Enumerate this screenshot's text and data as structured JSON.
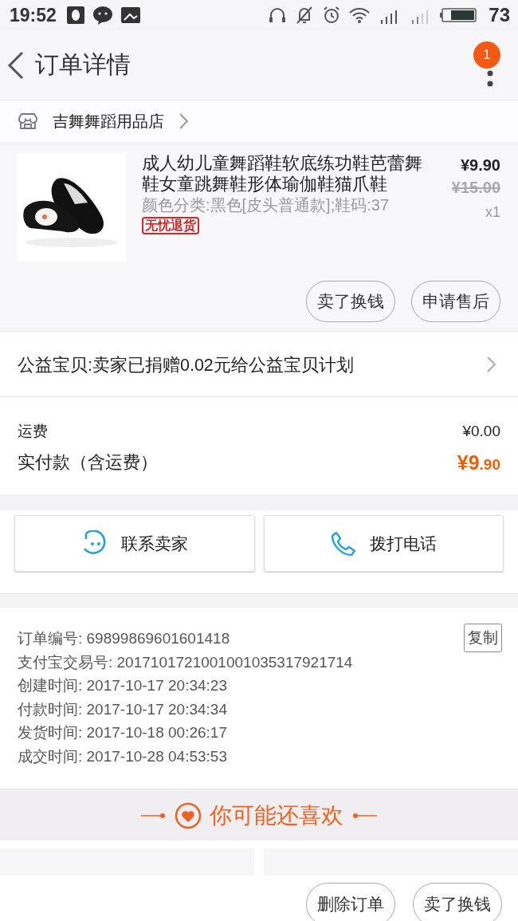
{
  "status_bar": {
    "time": "19:52",
    "battery": "73"
  },
  "header": {
    "title": "订单详情",
    "badge": "1"
  },
  "shop": {
    "name": "吉舞舞蹈用品店"
  },
  "item": {
    "title": "成人幼儿童舞蹈鞋软底练功鞋芭蕾舞鞋女童跳舞鞋形体瑜伽鞋猫爪鞋",
    "sku": "颜色分类:黑色[皮头普通款];鞋码:37",
    "tag": "无忧退货",
    "price": "¥9.90",
    "original_price": "¥15.00",
    "quantity": "x1",
    "actions": [
      "卖了换钱",
      "申请售后"
    ]
  },
  "charity": {
    "text": "公益宝贝:卖家已捐赠0.02元给公益宝贝计划"
  },
  "fees": [
    {
      "label": "运费",
      "value": "¥0.00",
      "kind": "plain"
    },
    {
      "label": "实付款（含运费）",
      "value": "¥9",
      "decimals": ".90",
      "kind": "total"
    }
  ],
  "contacts": [
    {
      "label": "联系卖家",
      "kind": "chat"
    },
    {
      "label": "拨打电话",
      "kind": "phone"
    }
  ],
  "order_info": {
    "copy": "复制",
    "rows": [
      "订单编号: 69899869601601418",
      "支付宝交易号: 2017101721001001035317921714",
      "创建时间: 2017-10-17 20:34:23",
      "付款时间: 2017-10-17 20:34:34",
      "发货时间: 2017-10-18 00:26:17",
      "成交时间: 2017-10-28 04:53:53"
    ]
  },
  "recommend": {
    "title": "你可能还喜欢"
  },
  "bottom_actions": [
    "删除订单",
    "卖了换钱"
  ]
}
